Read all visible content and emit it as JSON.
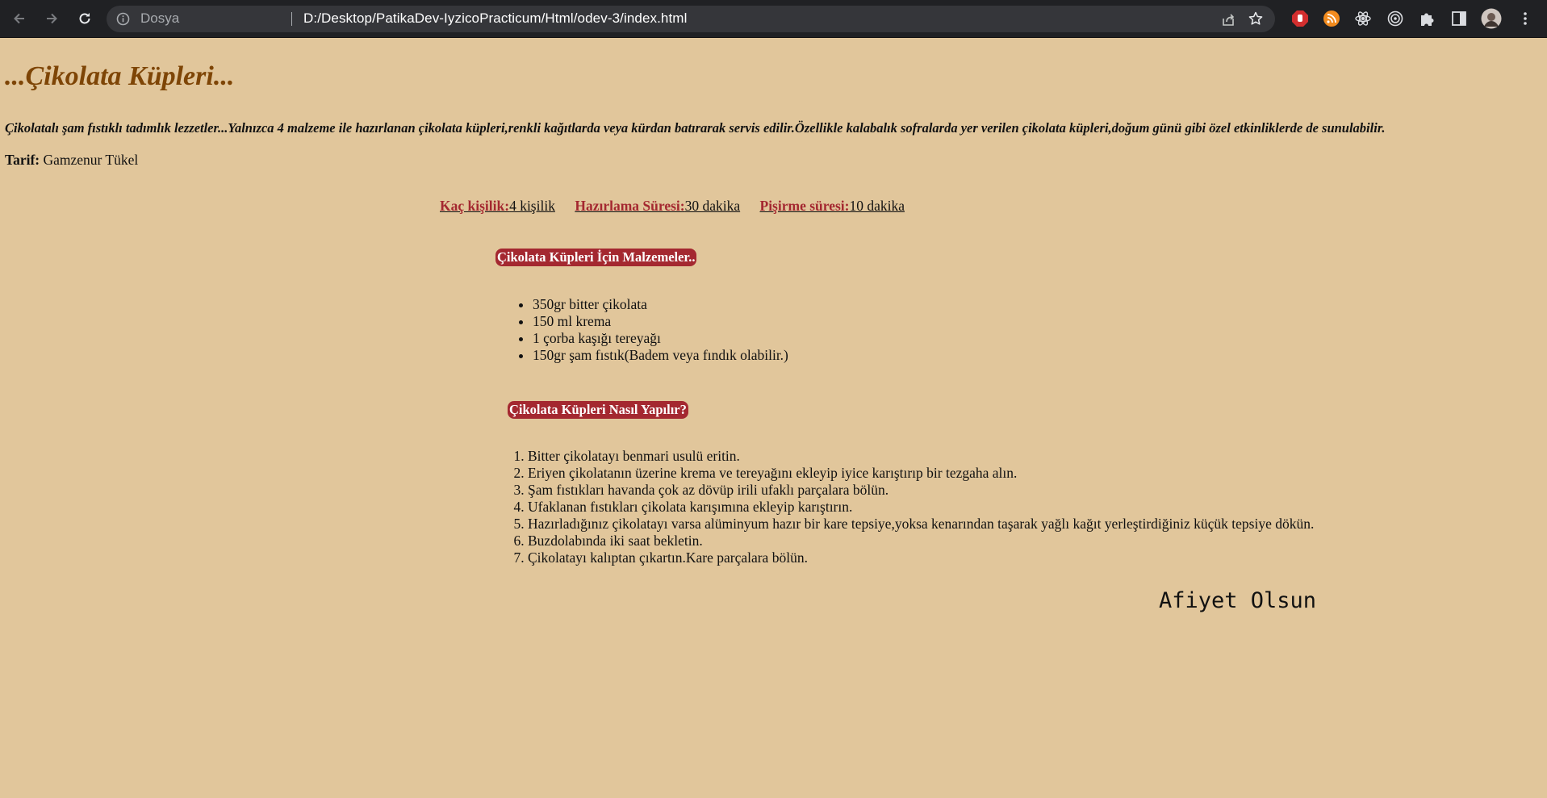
{
  "browser": {
    "scheme_label": "Dosya",
    "url": "D:/Desktop/PatikaDev-IyzicoPracticum/Html/odev-3/index.html",
    "icons": [
      "back-arrow-icon",
      "forward-arrow-icon",
      "reload-icon",
      "info-icon",
      "share-icon",
      "star-icon",
      "adblock-icon",
      "rss-icon",
      "react-devtools-icon",
      "target-icon",
      "puzzle-icon",
      "side-panel-icon",
      "profile-avatar",
      "kebab-menu-icon"
    ]
  },
  "page": {
    "title": "...Çikolata Küpleri...",
    "intro": "Çikolatalı şam fıstıklı tadımlık lezzetler...Yalnızca 4 malzeme ile hazırlanan çikolata küpleri,renkli kağıtlarda veya kürdan batırarak servis edilir.Özellikle kalabalık sofralarda yer verilen çikolata küpleri,doğum günü gibi özel etkinliklerde de sunulabilir.",
    "author_label": "Tarif:",
    "author_name": "Gamzenur Tükel",
    "meta": [
      {
        "label": "Kaç kişilik:",
        "value": "4 kişilik"
      },
      {
        "label": "Hazırlama Süresi:",
        "value": "30 dakika"
      },
      {
        "label": "Pişirme süresi:",
        "value": "10 dakika"
      }
    ],
    "ingredients_title": "Çikolata Küpleri İçin Malzemeler..",
    "ingredients": [
      "350gr bitter çikolata",
      "150 ml krema",
      "1 çorba kaşığı tereyağı",
      "150gr şam fıstık(Badem veya fındık olabilir.)"
    ],
    "steps_title": "Çikolata Küpleri Nasıl Yapılır?",
    "steps": [
      "Bitter çikolatayı benmari usulü eritin.",
      "Eriyen çikolatanın üzerine krema ve tereyağını ekleyip iyice karıştırıp bir tezgaha alın.",
      "Şam fıstıkları havanda çok az dövüp irili ufaklı parçalara bölün.",
      "Ufaklanan fıstıkları çikolata karışımına ekleyip karıştırın.",
      "Hazırladığınız çikolatayı varsa alüminyum hazır bir kare tepsiye,yoksa kenarından taşarak yağlı kağıt yerleştirdiğiniz küçük tepsiye dökün.",
      "Buzdolabında iki saat bekletin.",
      "Çikolatayı kalıptan çıkartın.Kare parçalara bölün."
    ],
    "closing": "Afiyet Olsun"
  },
  "colors": {
    "page_background": "#e1c69b",
    "title_color": "#7e4506",
    "accent_red": "#a42830",
    "chrome_background": "#202124",
    "omnibox_background": "#35363a"
  }
}
